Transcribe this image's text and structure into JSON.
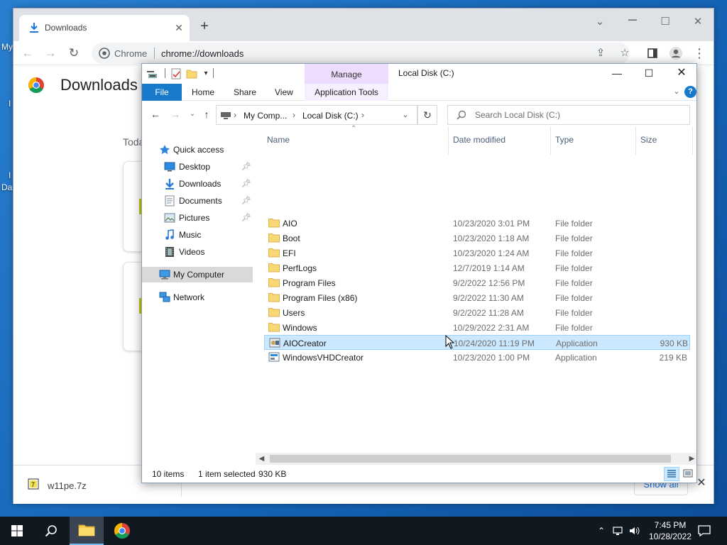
{
  "desktop": {
    "frag_1": "My",
    "frag_2": "I",
    "frag_3": "I",
    "frag_4": "Da"
  },
  "chrome": {
    "tab_title": "Downloads",
    "omnibox_label": "Chrome",
    "url": "chrome://downloads",
    "page_title": "Downloads",
    "section_today": "Toda",
    "shelf_file": "w11pe.7z",
    "shelf_show_all": "Show all"
  },
  "explorer": {
    "window_title": "Local Disk (C:)",
    "contextual_tab": "Manage",
    "ribbon_tabs": [
      "File",
      "Home",
      "Share",
      "View",
      "Application Tools"
    ],
    "address": {
      "crumb_1": "My Comp...",
      "crumb_2": "Local Disk (C:)"
    },
    "search_placeholder": "Search Local Disk (C:)",
    "nav": {
      "quick_access": "Quick access",
      "desktop": "Desktop",
      "downloads": "Downloads",
      "documents": "Documents",
      "pictures": "Pictures",
      "music": "Music",
      "videos": "Videos",
      "my_computer": "My Computer",
      "network": "Network"
    },
    "columns": {
      "name": "Name",
      "date": "Date modified",
      "type": "Type",
      "size": "Size"
    },
    "files": [
      {
        "name": "AIO",
        "date": "10/23/2020 3:01 PM",
        "type": "File folder",
        "size": ""
      },
      {
        "name": "Boot",
        "date": "10/23/2020 1:18 AM",
        "type": "File folder",
        "size": ""
      },
      {
        "name": "EFI",
        "date": "10/23/2020 1:24 AM",
        "type": "File folder",
        "size": ""
      },
      {
        "name": "PerfLogs",
        "date": "12/7/2019 1:14 AM",
        "type": "File folder",
        "size": ""
      },
      {
        "name": "Program Files",
        "date": "9/2/2022 12:56 PM",
        "type": "File folder",
        "size": ""
      },
      {
        "name": "Program Files (x86)",
        "date": "9/2/2022 11:30 AM",
        "type": "File folder",
        "size": ""
      },
      {
        "name": "Users",
        "date": "9/2/2022 11:28 AM",
        "type": "File folder",
        "size": ""
      },
      {
        "name": "Windows",
        "date": "10/29/2022 2:31 AM",
        "type": "File folder",
        "size": ""
      },
      {
        "name": "AIOCreator",
        "date": "10/24/2020 11:19 PM",
        "type": "Application",
        "size": "930 KB"
      },
      {
        "name": "WindowsVHDCreator",
        "date": "10/23/2020 1:00 PM",
        "type": "Application",
        "size": "219 KB"
      }
    ],
    "status": {
      "count": "10 items",
      "selection": "1 item selected",
      "size": "930 KB"
    }
  },
  "taskbar": {
    "time": "7:45 PM",
    "date": "10/28/2022"
  },
  "colors": {
    "accent": "#1979ca",
    "selection": "#cce8ff",
    "selection_border": "#99d1ff",
    "folder": "#f8d775",
    "manage_tab": "#eedcff"
  }
}
